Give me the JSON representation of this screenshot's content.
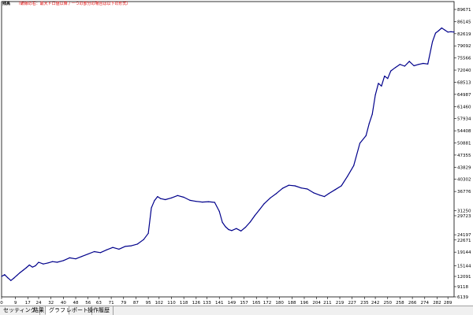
{
  "legend": {
    "title": "残高",
    "note": "（破線の右：最大ドロ値以降 / 一つの部分の場合は以下の形式）"
  },
  "tabs": [
    {
      "label": "セッティング",
      "active": false
    },
    {
      "label": "結果",
      "active": false
    },
    {
      "label": "グラフ",
      "active": true
    },
    {
      "label": "レポート",
      "active": false
    },
    {
      "label": "操作履歴",
      "active": false
    }
  ],
  "colors": {
    "line": "#00008b",
    "grid": "#c8c8c8",
    "axis": "#000000",
    "background": "#ffffff"
  },
  "chart_data": {
    "type": "line",
    "title": "",
    "xlabel": "",
    "ylabel": "",
    "x_ticks": [
      0,
      9,
      17,
      24,
      32,
      40,
      48,
      56,
      63,
      71,
      79,
      87,
      95,
      102,
      110,
      118,
      126,
      133,
      141,
      149,
      157,
      165,
      172,
      180,
      188,
      196,
      204,
      211,
      219,
      227,
      235,
      242,
      250,
      258,
      266,
      274,
      282,
      289
    ],
    "y_ticks": [
      6139,
      9118,
      12091,
      15144,
      19144,
      22671,
      24197,
      29723,
      31250,
      36776,
      40302,
      43829,
      47355,
      50881,
      54408,
      57934,
      61460,
      64987,
      68513,
      72040,
      75566,
      79092,
      82619,
      86145,
      89671
    ],
    "ylim": [
      6139,
      89671
    ],
    "xlim": [
      0,
      293
    ],
    "series": [
      {
        "x": [
          0,
          2,
          4,
          6,
          8,
          10,
          12,
          14,
          16,
          18,
          20,
          22,
          24,
          27,
          30,
          33,
          36,
          40,
          44,
          48,
          52,
          56,
          60,
          64,
          68,
          72,
          76,
          80,
          84,
          88,
          92,
          95,
          97,
          99,
          101,
          103,
          106,
          110,
          114,
          118,
          122,
          126,
          130,
          134,
          138,
          141,
          143,
          145,
          147,
          149,
          152,
          155,
          158,
          161,
          164,
          167,
          170,
          174,
          178,
          182,
          186,
          190,
          194,
          198,
          202,
          206,
          209,
          212,
          216,
          220,
          224,
          228,
          232,
          236,
          238,
          240,
          242,
          244,
          246,
          248,
          250,
          252,
          255,
          258,
          261,
          264,
          267,
          270,
          273,
          276,
          279,
          281,
          283,
          285,
          287,
          289,
          291,
          293
        ],
        "values": [
          12100,
          12600,
          11700,
          10900,
          11600,
          12400,
          13200,
          13900,
          14600,
          15400,
          14800,
          15200,
          16200,
          15700,
          16000,
          16400,
          16200,
          16700,
          17500,
          17200,
          17900,
          18600,
          19300,
          19000,
          19800,
          20500,
          20000,
          20800,
          21000,
          21500,
          22800,
          24600,
          32000,
          34100,
          35300,
          34700,
          34400,
          34900,
          35600,
          35100,
          34200,
          33900,
          33700,
          33800,
          33600,
          31000,
          27800,
          26500,
          25700,
          25400,
          26000,
          25300,
          26400,
          27900,
          29800,
          31500,
          33200,
          34900,
          36200,
          37700,
          38600,
          38400,
          37800,
          37500,
          36400,
          35700,
          35300,
          36200,
          37300,
          38400,
          41200,
          44300,
          50800,
          53000,
          56500,
          59200,
          64800,
          68200,
          67400,
          70300,
          69600,
          71800,
          72800,
          73700,
          73200,
          74600,
          73300,
          73700,
          74000,
          73800,
          80300,
          82800,
          83500,
          84300,
          83700,
          83100,
          83200,
          83100
        ]
      }
    ],
    "grid": false,
    "legend_position": "top-left"
  }
}
